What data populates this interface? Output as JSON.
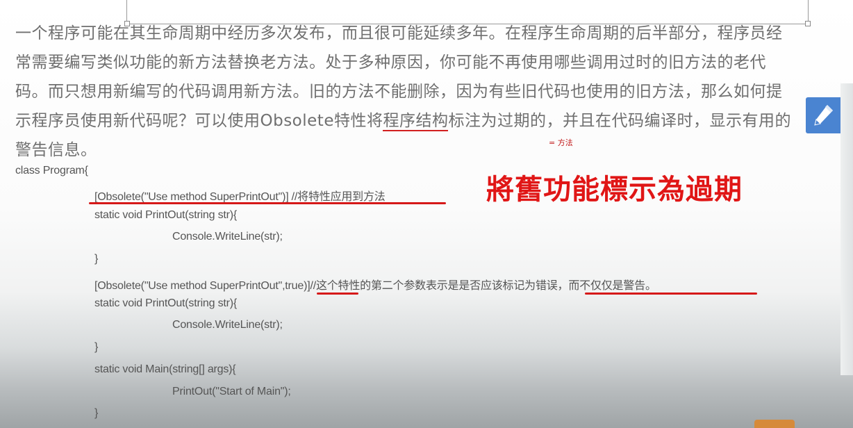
{
  "paragraph": {
    "before_underline": "一个程序可能在其生命周期中经历多次发布，而且很可能延续多年。在程序生命周期的后半部分，程序员经常需要编写类似功能的新方法替换老方法。处于多种原因，你可能不再使用哪些调用过时的旧方法的老代码。而只想用新编写的代码调用新方法。旧的方法不能删除，因为有些旧代码也使用的旧方法，那么如何提示程序员使用新代码呢？可以使用Obsolete特性将",
    "underlined": "程序结构",
    "after_underline": "标注为过期的，并且在代码编译时，显示有用的警告信息。"
  },
  "annotation_note": "= 方法",
  "title_overlay": "將舊功能標示為過期",
  "code": {
    "l1": "class Program{",
    "l2": "[Obsolete(\"Use method SuperPrintOut\")] //将特性应用到方法",
    "l3": "static void PrintOut(string str){",
    "l4": "Console.WriteLine(str);",
    "l5": "}",
    "l6": "[Obsolete(\"Use method SuperPrintOut\",true)]//这个特性的第二个参数表示是是否应该标记为错误，而不仅仅是警告。",
    "l7": "static void PrintOut(string str){",
    "l8": "Console.WriteLine(str);",
    "l9": "}",
    "l10": "static void Main(string[] args){",
    "l11": "PrintOut(\"Start of Main\");",
    "l12": "}"
  },
  "colors": {
    "accent_red": "#d61919",
    "edit_tab_blue": "#4a84d1"
  },
  "icons": {
    "edit": "pencil-icon"
  }
}
